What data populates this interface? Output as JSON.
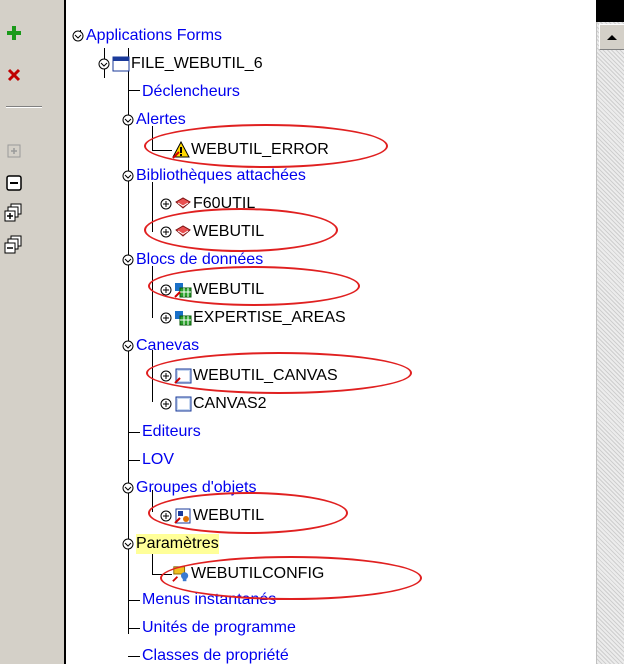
{
  "toolbar": {
    "add": "add-icon",
    "delete": "delete-icon",
    "expand": "expand-icon",
    "collapse": "collapse-icon",
    "expand_all": "expand-all-icon",
    "collapse_all": "collapse-all-icon"
  },
  "tree": {
    "root": "Applications Forms",
    "module": "FILE_WEBUTIL_6",
    "declencheurs": "Déclencheurs",
    "alertes": "Alertes",
    "alert_item": "WEBUTIL_ERROR",
    "bibliotheques": "Bibliothèques attachées",
    "lib_item1": "F60UTIL",
    "lib_item2": "WEBUTIL",
    "blocs": "Blocs de données",
    "block_item1": "WEBUTIL",
    "block_item2": "EXPERTISE_AREAS",
    "canevas": "Canevas",
    "canvas_item1": "WEBUTIL_CANVAS",
    "canvas_item2": "CANVAS2",
    "editeurs": "Editeurs",
    "lov": "LOV",
    "groupes": "Groupes d'objets",
    "group_item": "WEBUTIL",
    "parametres": "Paramètres",
    "param_item": "WEBUTILCONFIG",
    "menus": "Menus instantanés",
    "unites": "Unités de programme",
    "classes": "Classes de propriété"
  },
  "colors": {
    "link": "#0000ee",
    "highlight": "#ffff99",
    "annotation": "#e02020"
  }
}
